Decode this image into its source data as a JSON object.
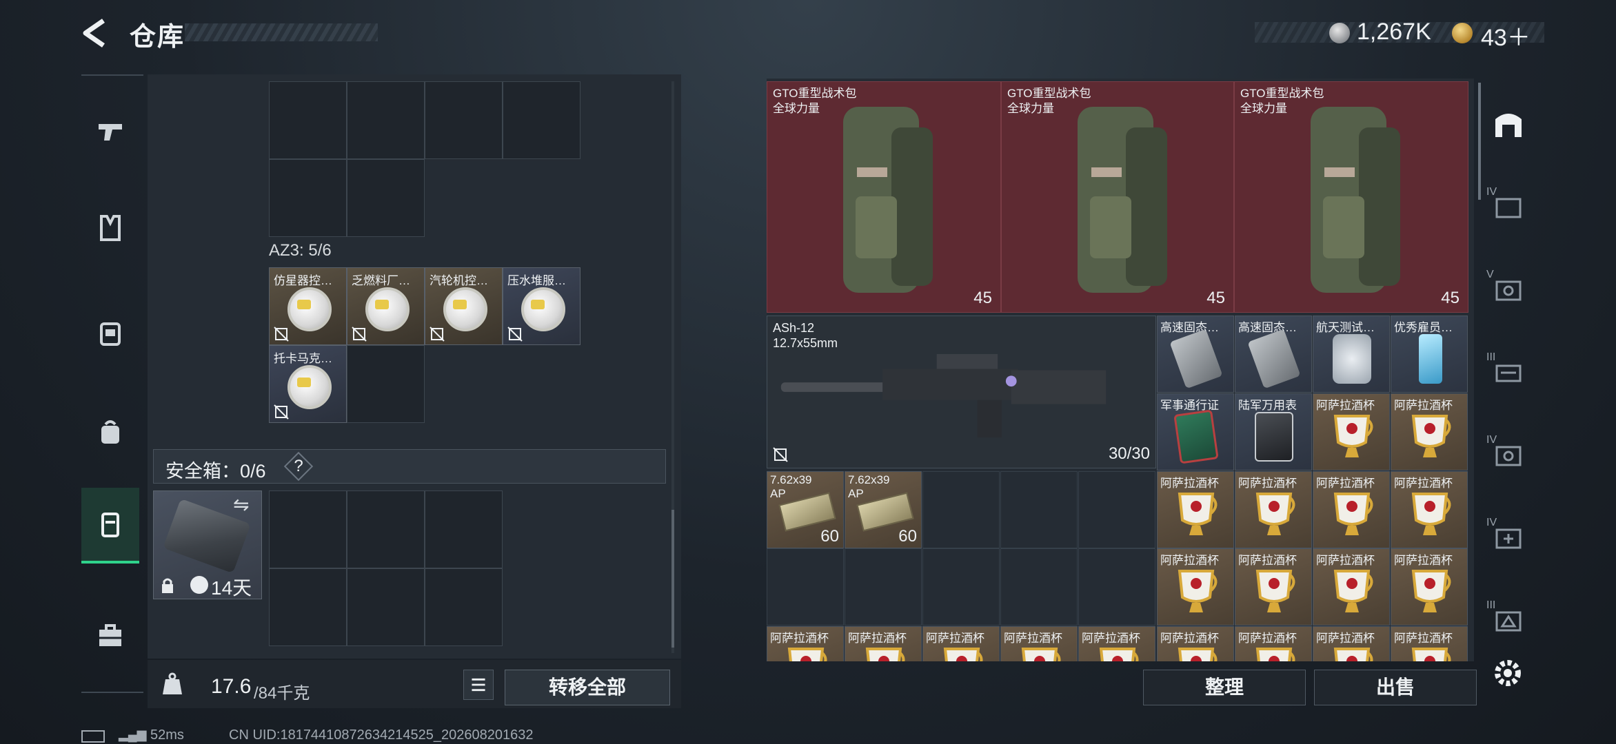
{
  "header": {
    "title": "仓库"
  },
  "currency": {
    "silver": "1,267K",
    "gold": "43＋"
  },
  "left": {
    "container_label": "AZ3: 5/6",
    "chips": [
      {
        "name": "仿星器控…"
      },
      {
        "name": "乏燃料厂…"
      },
      {
        "name": "汽轮机控…"
      },
      {
        "name": "压水堆服…"
      },
      {
        "name": "托卡马克…"
      }
    ],
    "safe_box": {
      "label": "安全箱：0/6",
      "help": "?",
      "days": "14天"
    },
    "weight": {
      "current": "17.6",
      "max": "/84千克"
    },
    "transfer_all": "转移全部"
  },
  "right": {
    "bags": [
      {
        "name": "GTO重型战术包",
        "sub": "全球力量",
        "count": "45"
      },
      {
        "name": "GTO重型战术包",
        "sub": "全球力量",
        "count": "45"
      },
      {
        "name": "GTO重型战术包",
        "sub": "全球力量",
        "count": "45"
      }
    ],
    "gun": {
      "name": "ASh-12",
      "caliber": "12.7x55mm",
      "ammo": "30/30"
    },
    "ammo": [
      {
        "name": "7.62x39",
        "sub": "AP",
        "count": "60"
      },
      {
        "name": "7.62x39",
        "sub": "AP",
        "count": "60"
      }
    ],
    "items_row1": [
      {
        "name": "高速固态…"
      },
      {
        "name": "高速固态…"
      },
      {
        "name": "航天测试…"
      },
      {
        "name": "优秀雇员…"
      }
    ],
    "items_row2": [
      {
        "name": "军事通行证"
      },
      {
        "name": "陆军万用表"
      },
      {
        "name": "阿萨拉酒杯"
      },
      {
        "name": "阿萨拉酒杯"
      }
    ],
    "cup_name": "阿萨拉酒杯",
    "sort": "整理",
    "sell": "出售",
    "tab_labels": [
      "IV",
      "V",
      "III",
      "IV",
      "IV",
      "III"
    ]
  },
  "status": {
    "ping": "52ms",
    "uid": "CN UID:18174410872634214525_202608201632"
  },
  "colors": {
    "accent": "#2fd38c",
    "bag_bg": "#5e2a32"
  }
}
